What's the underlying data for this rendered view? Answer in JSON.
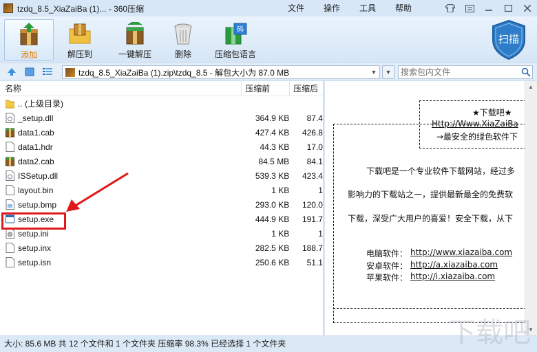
{
  "window": {
    "title": "tzdq_8.5_XiaZaiBa (1)... - 360压缩"
  },
  "menu": [
    "文件",
    "操作",
    "工具",
    "帮助"
  ],
  "toolbar": {
    "add": "添加",
    "extract_to": "解压到",
    "one_click_extract": "一键解压",
    "delete": "删除",
    "archive_language": "压缩包语言",
    "scan": "扫描"
  },
  "address": {
    "path": "tzdq_8.5_XiaZaiBa (1).zip\\tzdq_8.5 - 解包大小为 87.0 MB",
    "search_placeholder": "搜索包内文件"
  },
  "columns": {
    "name": "名称",
    "before": "压缩前",
    "after": "压缩后"
  },
  "files": [
    {
      "name": ".. (上级目录)",
      "before": "",
      "after": "",
      "icon": "folder-icon"
    },
    {
      "name": "_setup.dll",
      "before": "364.9 KB",
      "after": "87.4",
      "icon": "dll-file-icon"
    },
    {
      "name": "data1.cab",
      "before": "427.4 KB",
      "after": "426.8",
      "icon": "cab-archive-icon"
    },
    {
      "name": "data1.hdr",
      "before": "44.3 KB",
      "after": "17.0",
      "icon": "file-icon"
    },
    {
      "name": "data2.cab",
      "before": "84.5 MB",
      "after": "84.1",
      "icon": "cab-archive-icon"
    },
    {
      "name": "ISSetup.dll",
      "before": "539.3 KB",
      "after": "423.4",
      "icon": "dll-file-icon"
    },
    {
      "name": "layout.bin",
      "before": "1 KB",
      "after": "1",
      "icon": "file-icon"
    },
    {
      "name": "setup.bmp",
      "before": "293.0 KB",
      "after": "120.0",
      "icon": "image-file-icon"
    },
    {
      "name": "setup.exe",
      "before": "444.9 KB",
      "after": "191.7",
      "icon": "exe-file-icon"
    },
    {
      "name": "setup.ini",
      "before": "1 KB",
      "after": "1",
      "icon": "ini-file-icon"
    },
    {
      "name": "setup.inx",
      "before": "282.5 KB",
      "after": "188.7",
      "icon": "file-icon"
    },
    {
      "name": "setup.isn",
      "before": "250.6 KB",
      "after": "51.1",
      "icon": "file-icon"
    }
  ],
  "preview": {
    "header_title": "★下载吧★",
    "header_url": "Http://Www.XiaZaiBa",
    "header_slogan": "→最安全的绿色软件下",
    "para1": "下载吧是一个专业软件下载网站，经过多",
    "para2": "影响力的下载站之一，提供最新最全的免费软",
    "para3": "下载，深受广大用户的喜爱！安全下载，从下",
    "links": [
      {
        "label": "电脑软件：",
        "url": "http://www.xiazaiba.com"
      },
      {
        "label": "安卓软件：",
        "url": "http://a.xiazaiba.com"
      },
      {
        "label": "苹果软件：",
        "url": "http://i.xiazaiba.com"
      }
    ]
  },
  "status": "大小: 85.6 MB 共 12 个文件和 1 个文件夹 压缩率 98.3% 已经选择 1 个文件夹",
  "colors": {
    "highlight": "#e0191b",
    "accent": "#e07a00",
    "chrome": "#dbe9f7"
  }
}
